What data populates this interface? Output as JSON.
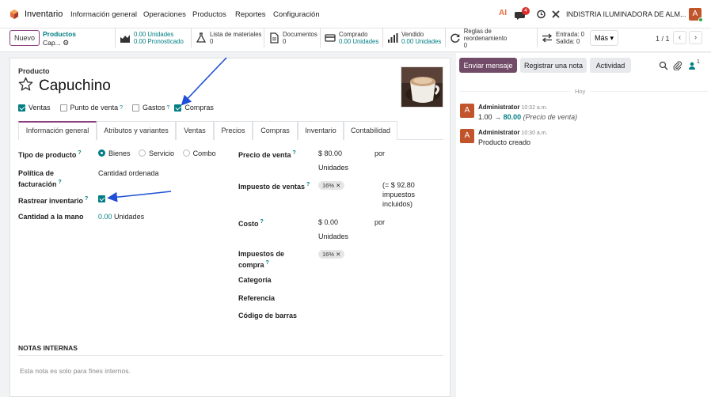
{
  "topbar": {
    "app_name": "Inventario",
    "nav": [
      "Información general",
      "Operaciones",
      "Productos",
      "Reportes",
      "Configuración"
    ],
    "ai_label": "AI",
    "notif_count": "4",
    "company": "INDISTRIA ILUMINADORA DE ALM...",
    "avatar_letter": "A"
  },
  "control": {
    "new_label": "Nuevo",
    "breadcrumb_parent": "Productos",
    "breadcrumb_current": "Cap...",
    "more_label": "Más ▾",
    "pager": "1 / 1"
  },
  "smart_buttons": [
    {
      "line1": "0.00 Unidades",
      "line2": "0.00 Pronosticado",
      "icon": "chart-area-icon"
    },
    {
      "line1": "Lista de materiales",
      "line2": "0",
      "icon": "flask-icon"
    },
    {
      "line1": "Documentos",
      "line2": "0",
      "icon": "document-icon"
    },
    {
      "line1": "Comprado",
      "line2": "0.00 Unidades",
      "icon": "credit-card-icon"
    },
    {
      "line1": "Vendido",
      "line2": "0.00 Unidades",
      "icon": "bar-chart-icon"
    },
    {
      "line1": "Reglas de reordenamiento",
      "line2": "0",
      "icon": "refresh-icon"
    },
    {
      "line1": "Entrada: 0",
      "line2": "Salida: 0",
      "icon": "exchange-icon"
    }
  ],
  "form": {
    "product_label": "Producto",
    "product_name": "Capuchino",
    "flags": [
      {
        "label": "Ventas",
        "checked": true,
        "help": false
      },
      {
        "label": "Punto de venta",
        "checked": false,
        "help": true
      },
      {
        "label": "Gastos",
        "checked": false,
        "help": true
      },
      {
        "label": "Compras",
        "checked": true,
        "help": false
      }
    ],
    "tabs": [
      "Información general",
      "Atributos y variantes",
      "Ventas",
      "Precios",
      "Compras",
      "Inventario",
      "Contabilidad"
    ],
    "left": {
      "tipo_label": "Tipo de producto",
      "tipo_options": [
        "Bienes",
        "Servicio",
        "Combo"
      ],
      "politica_label_1": "Política de",
      "politica_label_2": "facturación",
      "politica_value": "Cantidad ordenada",
      "rastrear_label": "Rastrear inventario",
      "cantidad_label": "Cantidad a la mano",
      "cantidad_value": "0.00",
      "cantidad_unit": "Unidades"
    },
    "right": {
      "precio_label": "Precio de venta",
      "precio_value": "$ 80.00",
      "precio_por": "por",
      "precio_unit": "Unidades",
      "impuesto_label": "Impuesto de ventas",
      "impuesto_tag": "16% ✕",
      "impuesto_note_1": "(= $ 92.80",
      "impuesto_note_2": "impuestos",
      "impuesto_note_3": "incluidos)",
      "costo_label": "Costo",
      "costo_value": "$ 0.00",
      "costo_por": "por",
      "costo_unit": "Unidades",
      "imp_compra_label_1": "Impuestos de",
      "imp_compra_label_2": "compra",
      "imp_compra_tag": "16% ✕",
      "categoria_label": "Categoría",
      "referencia_label": "Referencia",
      "barcode_label": "Código de barras"
    },
    "notes_title": "NOTAS INTERNAS",
    "notes_placeholder": "Esta nota es solo para fines internos."
  },
  "chatter": {
    "send_label": "Enviar mensaje",
    "note_label": "Registrar una nota",
    "activity_label": "Actividad",
    "followers": "1",
    "date_sep": "Hoy",
    "messages": [
      {
        "author": "Administrator",
        "time": "10:32 a.m.",
        "old": "1.00",
        "new": "80.00",
        "field": "(Precio de venta)"
      },
      {
        "author": "Administrator",
        "time": "10:30 a.m.",
        "text": "Producto creado"
      }
    ]
  }
}
